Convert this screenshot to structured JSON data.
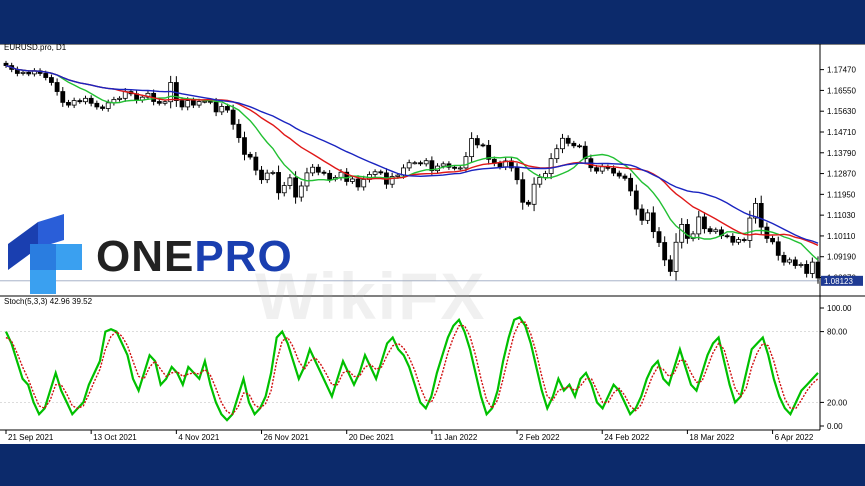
{
  "logo": {
    "brand_a": "ONE",
    "brand_b": "PRO"
  },
  "watermark": {
    "text": "WikiFX"
  },
  "price_panel": {
    "title": "EURUSD.pro, D1",
    "axis_labels": [
      "1.17470",
      "1.16550",
      "1.15630",
      "1.14710",
      "1.13790",
      "1.12870",
      "1.11950",
      "1.11030",
      "1.10110",
      "1.09190",
      "1.08270"
    ],
    "current_price": "1.08123"
  },
  "stoch_panel": {
    "title": "Stoch(5,3,3) 42.96 39.52",
    "axis_labels": [
      "100.00",
      "80.00",
      "20.00",
      "0.00"
    ]
  },
  "x_axis": {
    "labels": [
      "21 Sep 2021",
      "13 Oct 2021",
      "4 Nov 2021",
      "26 Nov 2021",
      "20 Dec 2021",
      "11 Jan 2022",
      "2 Feb 2022",
      "24 Feb 2022",
      "18 Mar 2022",
      "6 Apr 2022"
    ]
  },
  "chart_data": {
    "type": "line",
    "symbol": "EURUSD.pro",
    "timeframe": "D1",
    "ylim": [
      1.0785,
      1.1825
    ],
    "closes": [
      1.1765,
      1.1748,
      1.173,
      1.1735,
      1.1728,
      1.1742,
      1.173,
      1.1712,
      1.169,
      1.165,
      1.1602,
      1.159,
      1.161,
      1.1605,
      1.162,
      1.1598,
      1.1582,
      1.1575,
      1.16,
      1.1615,
      1.162,
      1.165,
      1.164,
      1.1612,
      1.1625,
      1.1642,
      1.1606,
      1.1598,
      1.1605,
      1.169,
      1.161,
      1.1582,
      1.161,
      1.159,
      1.1606,
      1.1607,
      1.1603,
      1.156,
      1.1584,
      1.1568,
      1.1505,
      1.1446,
      1.1372,
      1.136,
      1.1302,
      1.126,
      1.1289,
      1.1292,
      1.1202,
      1.1234,
      1.1268,
      1.1183,
      1.1232,
      1.129,
      1.1315,
      1.1293,
      1.1288,
      1.1262,
      1.127,
      1.1293,
      1.1252,
      1.1263,
      1.1228,
      1.1261,
      1.1283,
      1.1295,
      1.129,
      1.124,
      1.1274,
      1.128,
      1.1312,
      1.1335,
      1.1335,
      1.133,
      1.1344,
      1.13,
      1.132,
      1.133,
      1.1315,
      1.131,
      1.1312,
      1.1362,
      1.1442,
      1.1414,
      1.1412,
      1.135,
      1.1332,
      1.1317,
      1.1343,
      1.1312,
      1.126,
      1.116,
      1.1151,
      1.124,
      1.127,
      1.1287,
      1.1353,
      1.1397,
      1.1443,
      1.1421,
      1.141,
      1.1408,
      1.1353,
      1.1313,
      1.1298,
      1.1317,
      1.131,
      1.1289,
      1.1276,
      1.1266,
      1.121,
      1.113,
      1.108,
      1.1113,
      1.103,
      1.0982,
      1.0905,
      1.0854,
      1.0983,
      1.1062,
      1.1,
      1.102,
      1.1095,
      1.1043,
      1.103,
      1.1038,
      1.1012,
      1.1009,
      1.0983,
      1.0995,
      1.0991,
      1.109,
      1.1155,
      1.105,
      1.1,
      1.0985,
      1.0925,
      1.0895,
      1.0905,
      1.088,
      1.0885,
      1.0845,
      1.0895,
      1.0825
    ],
    "series": [
      {
        "name": "",
        "color": "#00c000",
        "values": [
          80,
          70,
          55,
          40,
          35,
          20,
          10,
          15,
          30,
          45,
          30,
          20,
          10,
          15,
          20,
          35,
          45,
          55,
          80,
          82,
          80,
          70,
          60,
          40,
          30,
          45,
          60,
          55,
          35,
          40,
          50,
          45,
          35,
          50,
          45,
          40,
          55,
          35,
          20,
          10,
          5,
          10,
          25,
          40,
          20,
          10,
          15,
          25,
          45,
          75,
          80,
          70,
          55,
          40,
          50,
          65,
          55,
          45,
          35,
          25,
          40,
          55,
          45,
          35,
          45,
          60,
          50,
          40,
          55,
          70,
          75,
          65,
          60,
          50,
          35,
          20,
          15,
          25,
          45,
          60,
          75,
          85,
          90,
          80,
          65,
          45,
          25,
          10,
          15,
          30,
          55,
          75,
          90,
          92,
          85,
          70,
          50,
          30,
          15,
          25,
          40,
          30,
          35,
          25,
          40,
          45,
          35,
          20,
          15,
          25,
          35,
          30,
          20,
          10,
          15,
          25,
          40,
          50,
          55,
          40,
          35,
          50,
          65,
          50,
          35,
          30,
          45,
          60,
          70,
          75,
          55,
          35,
          20,
          25,
          45,
          65,
          70,
          75,
          60,
          40,
          25,
          15,
          10,
          20,
          30,
          35,
          40,
          45
        ]
      },
      {
        "name": "",
        "color": "#d01010",
        "values": [
          75,
          72,
          62,
          50,
          40,
          28,
          17,
          15,
          22,
          35,
          35,
          27,
          17,
          15,
          17,
          27,
          38,
          48,
          65,
          76,
          80,
          76,
          68,
          55,
          42,
          40,
          50,
          55,
          48,
          42,
          45,
          46,
          42,
          44,
          45,
          44,
          48,
          43,
          32,
          20,
          12,
          10,
          16,
          28,
          27,
          18,
          15,
          19,
          30,
          55,
          72,
          75,
          67,
          55,
          48,
          55,
          58,
          52,
          44,
          35,
          35,
          45,
          47,
          42,
          42,
          50,
          52,
          48,
          50,
          60,
          68,
          70,
          66,
          58,
          47,
          33,
          22,
          20,
          30,
          45,
          62,
          75,
          85,
          85,
          76,
          60,
          40,
          22,
          15,
          22,
          40,
          60,
          78,
          88,
          88,
          78,
          62,
          42,
          25,
          22,
          30,
          32,
          33,
          30,
          34,
          40,
          40,
          30,
          20,
          20,
          28,
          32,
          26,
          17,
          13,
          18,
          30,
          42,
          50,
          48,
          42,
          45,
          56,
          55,
          45,
          37,
          38,
          50,
          62,
          70,
          65,
          48,
          32,
          25,
          32,
          50,
          62,
          70,
          68,
          55,
          38,
          23,
          15,
          15,
          22,
          30,
          36,
          40
        ]
      }
    ]
  }
}
